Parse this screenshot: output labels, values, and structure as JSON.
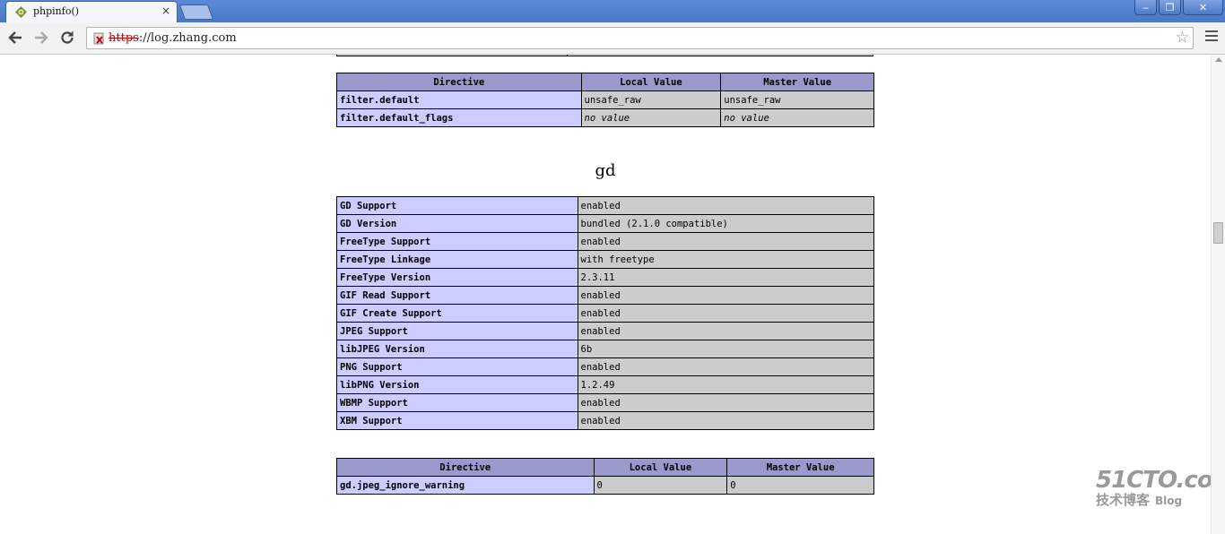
{
  "browser": {
    "tab_title": "phpinfo()",
    "tab_close": "×",
    "url_scheme": "https",
    "url_rest": "://log.zhang.com",
    "window_buttons": [
      "‒",
      "❐",
      "✕"
    ]
  },
  "filter_table": {
    "headers": [
      "Directive",
      "Local Value",
      "Master Value"
    ],
    "rows": [
      {
        "name": "filter.default",
        "local": "unsafe_raw",
        "master": "unsafe_raw"
      },
      {
        "name": "filter.default_flags",
        "local": "no value",
        "master": "no value"
      }
    ]
  },
  "gd_section": {
    "title": "gd",
    "info_rows": [
      {
        "name": "GD Support",
        "value": "enabled"
      },
      {
        "name": "GD Version",
        "value": "bundled (2.1.0 compatible)"
      },
      {
        "name": "FreeType Support",
        "value": "enabled"
      },
      {
        "name": "FreeType Linkage",
        "value": "with freetype"
      },
      {
        "name": "FreeType Version",
        "value": "2.3.11"
      },
      {
        "name": "GIF Read Support",
        "value": "enabled"
      },
      {
        "name": "GIF Create Support",
        "value": "enabled"
      },
      {
        "name": "JPEG Support",
        "value": "enabled"
      },
      {
        "name": "libJPEG Version",
        "value": "6b"
      },
      {
        "name": "PNG Support",
        "value": "enabled"
      },
      {
        "name": "libPNG Version",
        "value": "1.2.49"
      },
      {
        "name": "WBMP Support",
        "value": "enabled"
      },
      {
        "name": "XBM Support",
        "value": "enabled"
      }
    ],
    "directive_headers": [
      "Directive",
      "Local Value",
      "Master Value"
    ],
    "directive_rows": [
      {
        "name": "gd.jpeg_ignore_warning",
        "local": "0",
        "master": "0"
      }
    ]
  },
  "watermark": {
    "main": "51CTO.com",
    "sub": "技术博客",
    "blog": "Blog"
  }
}
